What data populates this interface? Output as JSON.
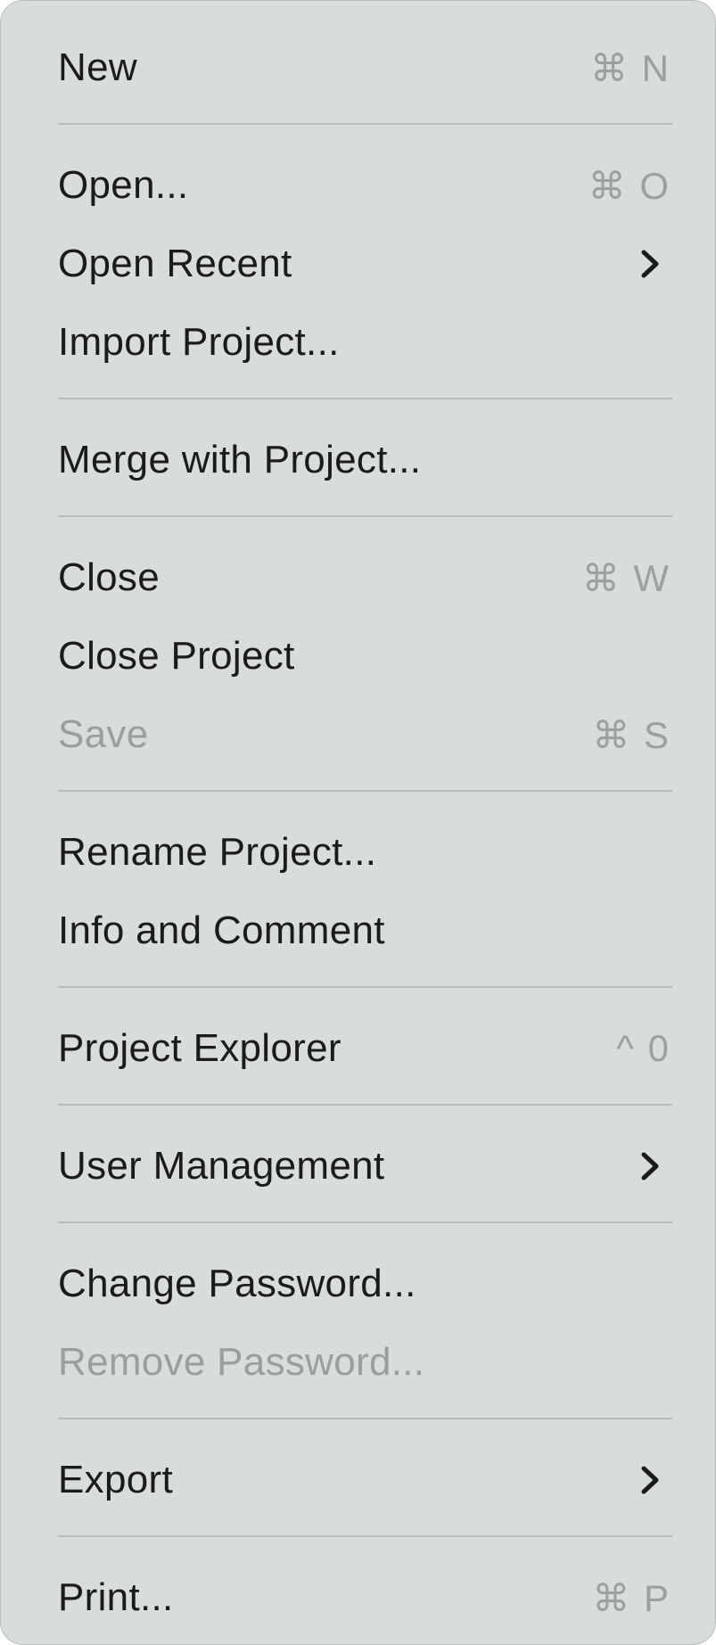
{
  "menu": {
    "items": [
      {
        "label": "New",
        "shortcut": "⌘ N"
      },
      {
        "label": "Open...",
        "shortcut": "⌘ O"
      },
      {
        "label": "Open Recent",
        "submenu": true
      },
      {
        "label": "Import Project..."
      },
      {
        "label": "Merge with Project..."
      },
      {
        "label": "Close",
        "shortcut": "⌘ W"
      },
      {
        "label": "Close Project"
      },
      {
        "label": "Save",
        "shortcut": "⌘ S",
        "disabled": true
      },
      {
        "label": "Rename Project..."
      },
      {
        "label": "Info and Comment"
      },
      {
        "label": "Project Explorer",
        "shortcut": "^ 0"
      },
      {
        "label": "User Management",
        "submenu": true
      },
      {
        "label": "Change Password..."
      },
      {
        "label": "Remove Password...",
        "disabled": true
      },
      {
        "label": "Export",
        "submenu": true
      },
      {
        "label": "Print...",
        "shortcut": "⌘ P"
      }
    ]
  },
  "colors": {
    "background": "#d8ddd9",
    "text": "#1b1b1b",
    "shortcut": "#9da09e",
    "disabled": "#9b9e9c",
    "separator": "#b9bebb"
  }
}
